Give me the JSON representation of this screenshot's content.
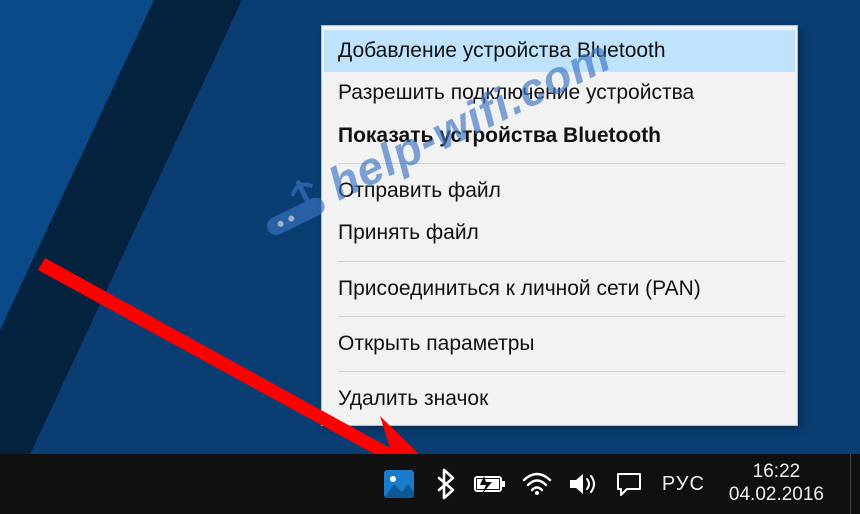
{
  "menu": {
    "add_device": "Добавление устройства Bluetooth",
    "allow_connect": "Разрешить подключение устройства",
    "show_devices": "Показать устройства Bluetooth",
    "send_file": "Отправить файл",
    "receive_file": "Принять файл",
    "join_pan": "Присоединиться к личной сети (PAN)",
    "open_settings": "Открыть параметры",
    "remove_icon": "Удалить значок"
  },
  "taskbar": {
    "language": "РУС",
    "time": "16:22",
    "date": "04.02.2016"
  },
  "watermark": {
    "text": "help-wifi.com"
  },
  "icons": {
    "photos": "photos-icon",
    "bluetooth": "bluetooth-icon",
    "battery": "battery-icon",
    "wifi": "wifi-icon",
    "volume": "volume-icon",
    "notifications": "action-center-icon"
  }
}
